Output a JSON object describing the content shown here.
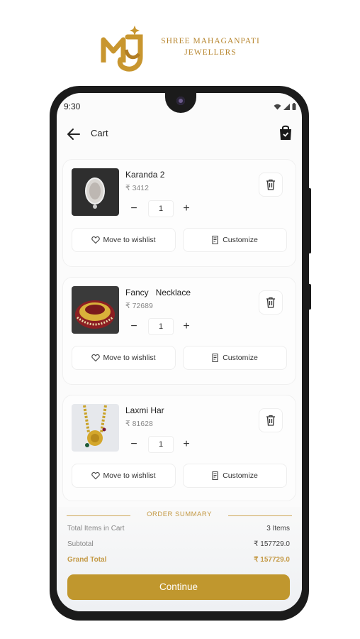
{
  "brand": {
    "line1": "SHREE MAHAGANPATI",
    "line2": "JEWELLERS",
    "color": "#b7862f"
  },
  "status": {
    "time": "9:30",
    "icons": [
      "wifi-icon",
      "signal-icon",
      "battery-icon"
    ]
  },
  "appbar": {
    "title": "Cart",
    "back_icon": "arrow-left-icon",
    "bag_icon": "shopping-bag-icon"
  },
  "cart": {
    "items": [
      {
        "name": "Karanda 2",
        "price": "₹ 3412",
        "qty": "1"
      },
      {
        "name": "Fancy   Necklace",
        "price": "₹ 72689",
        "qty": "1"
      },
      {
        "name": "Laxmi Har",
        "price": "₹ 81628",
        "qty": "1"
      }
    ],
    "minus": "−",
    "plus": "+",
    "wishlist_label": "Move to wishlist",
    "customize_label": "Customize"
  },
  "summary": {
    "title": "ORDER SUMMARY",
    "total_items_label": "Total Items in Cart",
    "total_items_value": "3 Items",
    "subtotal_label": "Subtotal",
    "subtotal_value": "₹ 157729.0",
    "grand_total_label": "Grand Total",
    "grand_total_value": "₹ 157729.0",
    "continue_label": "Continue",
    "accent": "#c0972e"
  }
}
